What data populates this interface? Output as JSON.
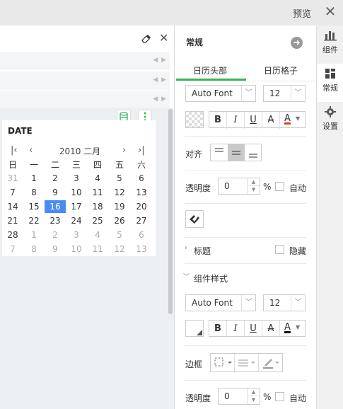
{
  "topbar": {
    "preview_label": "预览",
    "close_glyph": "✕"
  },
  "canvas": {
    "calendar": {
      "title": "DATE",
      "month_label": "2010 二月",
      "nav": {
        "first": "|‹",
        "prev": "‹",
        "next": "›",
        "last": "›|"
      },
      "weekdays": [
        "日",
        "一",
        "二",
        "三",
        "四",
        "五",
        "六"
      ],
      "weeks": [
        [
          "31",
          "1",
          "2",
          "3",
          "4",
          "5",
          "6"
        ],
        [
          "7",
          "8",
          "9",
          "10",
          "11",
          "12",
          "13"
        ],
        [
          "14",
          "15",
          "16",
          "17",
          "18",
          "19",
          "20"
        ],
        [
          "21",
          "22",
          "23",
          "24",
          "25",
          "26",
          "27"
        ],
        [
          "28",
          "1",
          "2",
          "3",
          "4",
          "5",
          "6"
        ],
        [
          "7",
          "8",
          "9",
          "10",
          "11",
          "12",
          "13"
        ]
      ],
      "selected_day": "16"
    }
  },
  "settings": {
    "title": "常规",
    "tabs": [
      "日历头部",
      "日历格子"
    ],
    "active_tab": 0,
    "header_font": {
      "family": "Auto Font",
      "size": "12"
    },
    "format_buttons": {
      "bold": "B",
      "italic": "I",
      "underline": "U",
      "strike": "A",
      "color": "A"
    },
    "align_label": "对齐",
    "opacity_label": "透明度",
    "opacity_value": "0",
    "percent": "%",
    "auto_label": "自动",
    "title_section": "标题",
    "hide_label": "隐藏",
    "widget_style_section": "组件样式",
    "widget_font": {
      "family": "Auto Font",
      "size": "12"
    },
    "border_label": "边框",
    "opacity2_label": "透明度",
    "opacity2_value": "0",
    "percent2": "%",
    "auto2_label": "自动"
  },
  "sidetabs": [
    {
      "label": "组件",
      "icon": "bar-chart-icon"
    },
    {
      "label": "常规",
      "icon": "grid-icon"
    },
    {
      "label": "设置",
      "icon": "gear-icon"
    }
  ],
  "colors": {
    "accent_green": "#3ab55a",
    "selected_blue": "#4b8cf0",
    "text_color_red": "#e8382b"
  }
}
